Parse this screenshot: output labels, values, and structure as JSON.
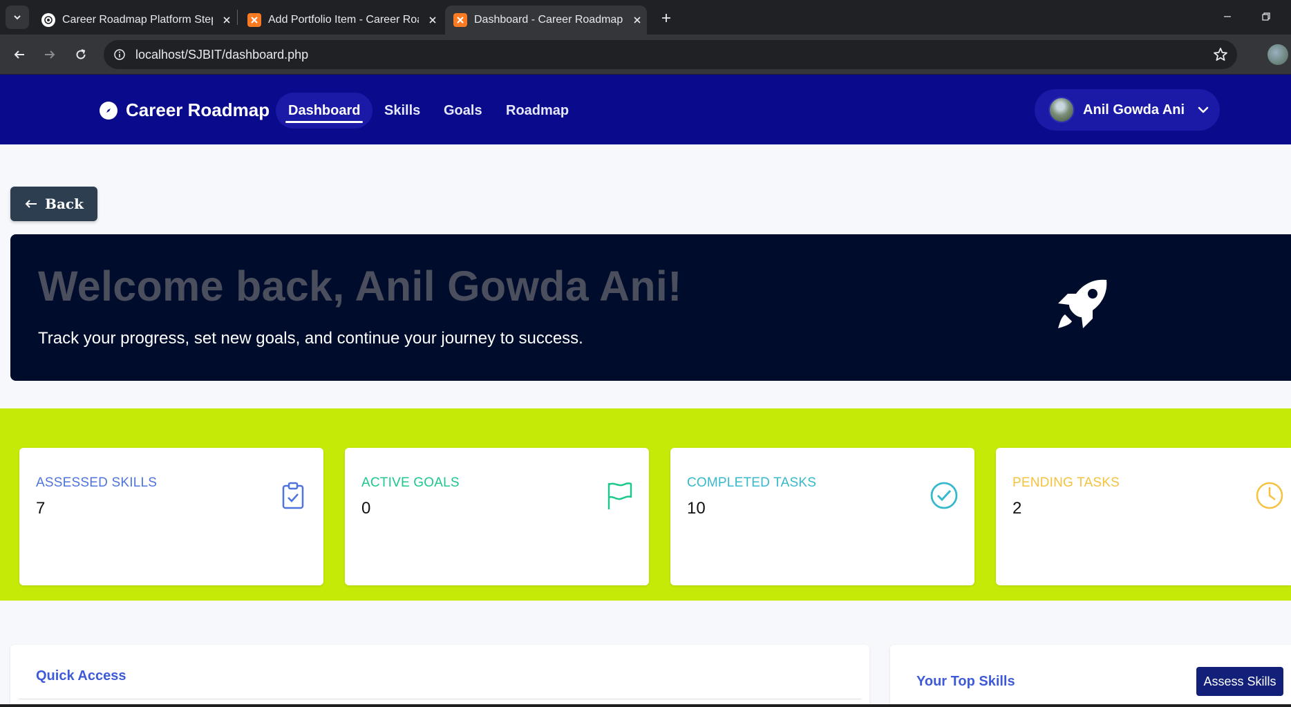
{
  "browser": {
    "tabs": [
      {
        "title": "Career Roadmap Platform Steps",
        "favicon": "chatgpt-icon",
        "active": false
      },
      {
        "title": "Add Portfolio Item - Career Roadmap",
        "favicon": "xampp-icon",
        "active": false
      },
      {
        "title": "Dashboard - Career Roadmap Generator",
        "favicon": "xampp-icon",
        "active": true
      }
    ],
    "url": "localhost/SJBIT/dashboard.php"
  },
  "navbar": {
    "brand": "Career Roadmap",
    "links": [
      {
        "label": "Dashboard",
        "active": true
      },
      {
        "label": "Skills",
        "active": false
      },
      {
        "label": "Goals",
        "active": false
      },
      {
        "label": "Roadmap",
        "active": false
      }
    ],
    "user_name": "Anil Gowda Ani"
  },
  "back_label": "Back",
  "hero": {
    "title": "Welcome back, Anil Gowda Ani!",
    "subtitle": "Track your progress, set new goals, and continue your journey to success."
  },
  "stats": [
    {
      "label": "ASSESSED SKILLS",
      "value": "7",
      "color": "#4e73df",
      "icon": "clipboard-check-icon"
    },
    {
      "label": "ACTIVE GOALS",
      "value": "0",
      "color": "#1cc88a",
      "icon": "flag-icon"
    },
    {
      "label": "COMPLETED TASKS",
      "value": "10",
      "color": "#36b9cc",
      "icon": "check-circle-icon"
    },
    {
      "label": "PENDING TASKS",
      "value": "2",
      "color": "#f6c23e",
      "icon": "clock-icon"
    }
  ],
  "quick_access": {
    "title": "Quick Access"
  },
  "top_skills": {
    "title": "Your Top Skills",
    "button": "Assess Skills"
  },
  "colors": {
    "navbar": "#0a0a8c",
    "hero_bg": "#000c2c",
    "stats_band": "#c6ea08",
    "accent": "#3e5ad8"
  }
}
